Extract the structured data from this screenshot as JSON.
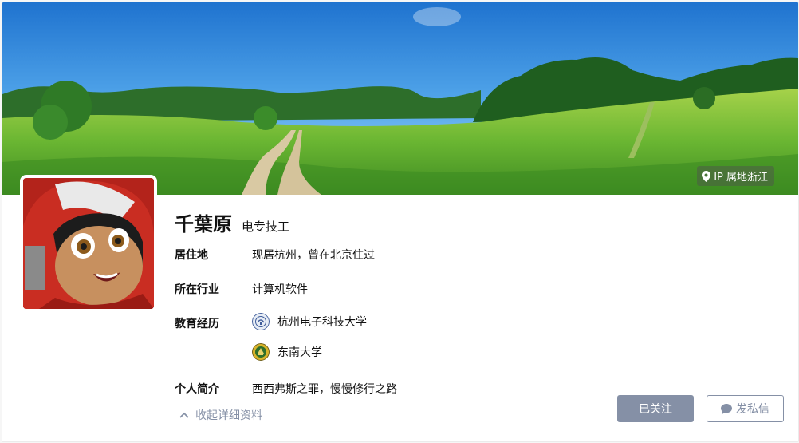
{
  "profile": {
    "name": "千葉原",
    "headline": "电专技工",
    "ip_location": "IP 属地浙江"
  },
  "info": {
    "residence_label": "居住地",
    "residence_value": "现居杭州，曾在北京住过",
    "industry_label": "所在行业",
    "industry_value": "计算机软件",
    "education_label": "教育经历",
    "education": [
      {
        "school": "杭州电子科技大学",
        "icon": "university-logo-icon"
      },
      {
        "school": "东南大学",
        "icon": "university-logo-icon"
      }
    ],
    "bio_label": "个人简介",
    "bio_value": "西西弗斯之罪，慢慢修行之路"
  },
  "actions": {
    "collapse_label": "收起详细资料",
    "follow_label": "已关注",
    "message_label": "发私信"
  },
  "colors": {
    "muted": "#8590a6",
    "text": "#121212",
    "sky": "#2f86d8",
    "grass": "#5aa82c"
  }
}
